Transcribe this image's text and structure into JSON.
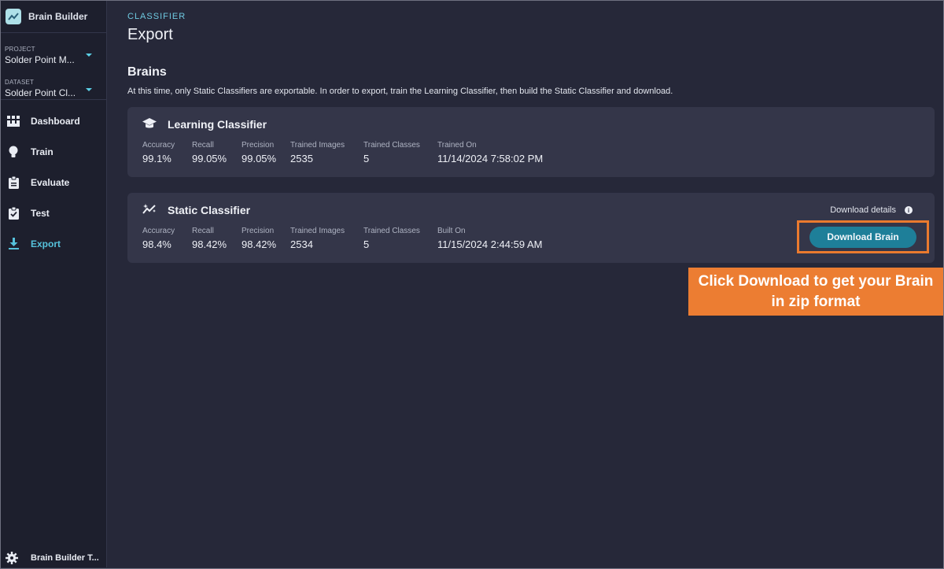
{
  "app": {
    "name": "Brain Builder",
    "accent": "#56c2dc"
  },
  "sidebar": {
    "project_label": "PROJECT",
    "project_value": "Solder Point M...",
    "dataset_label": "DATASET",
    "dataset_value": "Solder Point Cl...",
    "items": [
      {
        "label": "Dashboard",
        "icon": "grid-icon"
      },
      {
        "label": "Train",
        "icon": "lightbulb-icon"
      },
      {
        "label": "Evaluate",
        "icon": "clipboard-icon"
      },
      {
        "label": "Test",
        "icon": "clipboard-check-icon"
      },
      {
        "label": "Export",
        "icon": "download-icon",
        "active": true
      }
    ],
    "footer_label": "Brain Builder T..."
  },
  "header": {
    "breadcrumb": "CLASSIFIER",
    "title": "Export"
  },
  "brains": {
    "heading": "Brains",
    "description": "At this time, only Static Classifiers are exportable. In order to export, train the Learning Classifier, then build the Static Classifier and download.",
    "learning": {
      "title": "Learning Classifier",
      "stats": [
        {
          "label": "Accuracy",
          "value": "99.1%"
        },
        {
          "label": "Recall",
          "value": "99.05%"
        },
        {
          "label": "Precision",
          "value": "99.05%"
        },
        {
          "label": "Trained Images",
          "value": "2535"
        },
        {
          "label": "Trained Classes",
          "value": "5"
        },
        {
          "label": "Trained On",
          "value": "11/14/2024 7:58:02 PM"
        }
      ]
    },
    "static": {
      "title": "Static Classifier",
      "stats": [
        {
          "label": "Accuracy",
          "value": "98.4%"
        },
        {
          "label": "Recall",
          "value": "98.42%"
        },
        {
          "label": "Precision",
          "value": "98.42%"
        },
        {
          "label": "Trained Images",
          "value": "2534"
        },
        {
          "label": "Trained Classes",
          "value": "5"
        },
        {
          "label": "Built On",
          "value": "11/15/2024 2:44:59 AM"
        }
      ],
      "download_details": "Download details",
      "download_button": "Download Brain"
    }
  },
  "callout": {
    "text": "Click Download to get your Brain in zip format",
    "color": "#ec7d32"
  }
}
